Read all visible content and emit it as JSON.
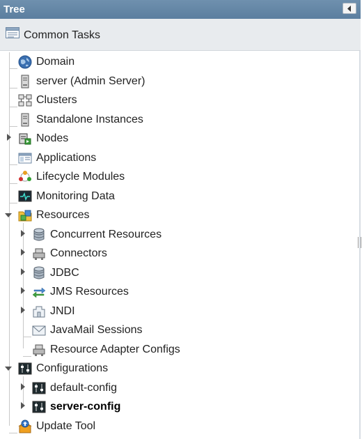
{
  "panel": {
    "title": "Tree",
    "collapse_icon": "chevron-left-icon"
  },
  "common_tasks": {
    "label": "Common Tasks",
    "icon": "tasks-icon"
  },
  "tree": {
    "domain": {
      "label": "Domain",
      "icon": "globe-icon"
    },
    "server": {
      "label": "server (Admin Server)",
      "icon": "server-icon"
    },
    "clusters": {
      "label": "Clusters",
      "icon": "cluster-icon"
    },
    "standalone": {
      "label": "Standalone Instances",
      "icon": "server-icon"
    },
    "nodes": {
      "label": "Nodes",
      "icon": "nodes-icon",
      "expanded": false
    },
    "applications": {
      "label": "Applications",
      "icon": "applications-icon"
    },
    "lifecycle": {
      "label": "Lifecycle Modules",
      "icon": "lifecycle-icon"
    },
    "monitoring": {
      "label": "Monitoring Data",
      "icon": "monitor-icon"
    },
    "resources": {
      "label": "Resources",
      "icon": "resources-folder-icon",
      "expanded": true,
      "children": {
        "concurrent": {
          "label": "Concurrent Resources",
          "icon": "database-icon",
          "expanded": false
        },
        "connectors": {
          "label": "Connectors",
          "icon": "connector-icon",
          "expanded": false
        },
        "jdbc": {
          "label": "JDBC",
          "icon": "database-icon",
          "expanded": false
        },
        "jms": {
          "label": "JMS Resources",
          "icon": "jms-arrows-icon",
          "expanded": false
        },
        "jndi": {
          "label": "JNDI",
          "icon": "jndi-icon",
          "expanded": false
        },
        "javamail": {
          "label": "JavaMail Sessions",
          "icon": "mail-icon"
        },
        "resource_adapter": {
          "label": "Resource Adapter Configs",
          "icon": "connector-icon"
        }
      }
    },
    "configurations": {
      "label": "Configurations",
      "icon": "config-icon",
      "expanded": true,
      "children": {
        "default_config": {
          "label": "default-config",
          "icon": "config-icon",
          "expanded": false
        },
        "server_config": {
          "label": "server-config",
          "icon": "config-icon",
          "expanded": false,
          "selected": true
        }
      }
    },
    "update_tool": {
      "label": "Update Tool",
      "icon": "update-tool-icon"
    }
  },
  "colors": {
    "titlebar": "#5b7e9f",
    "common_tasks_bg": "#e8ebee",
    "tree_line": "#c8c8c8",
    "text": "#222222"
  }
}
